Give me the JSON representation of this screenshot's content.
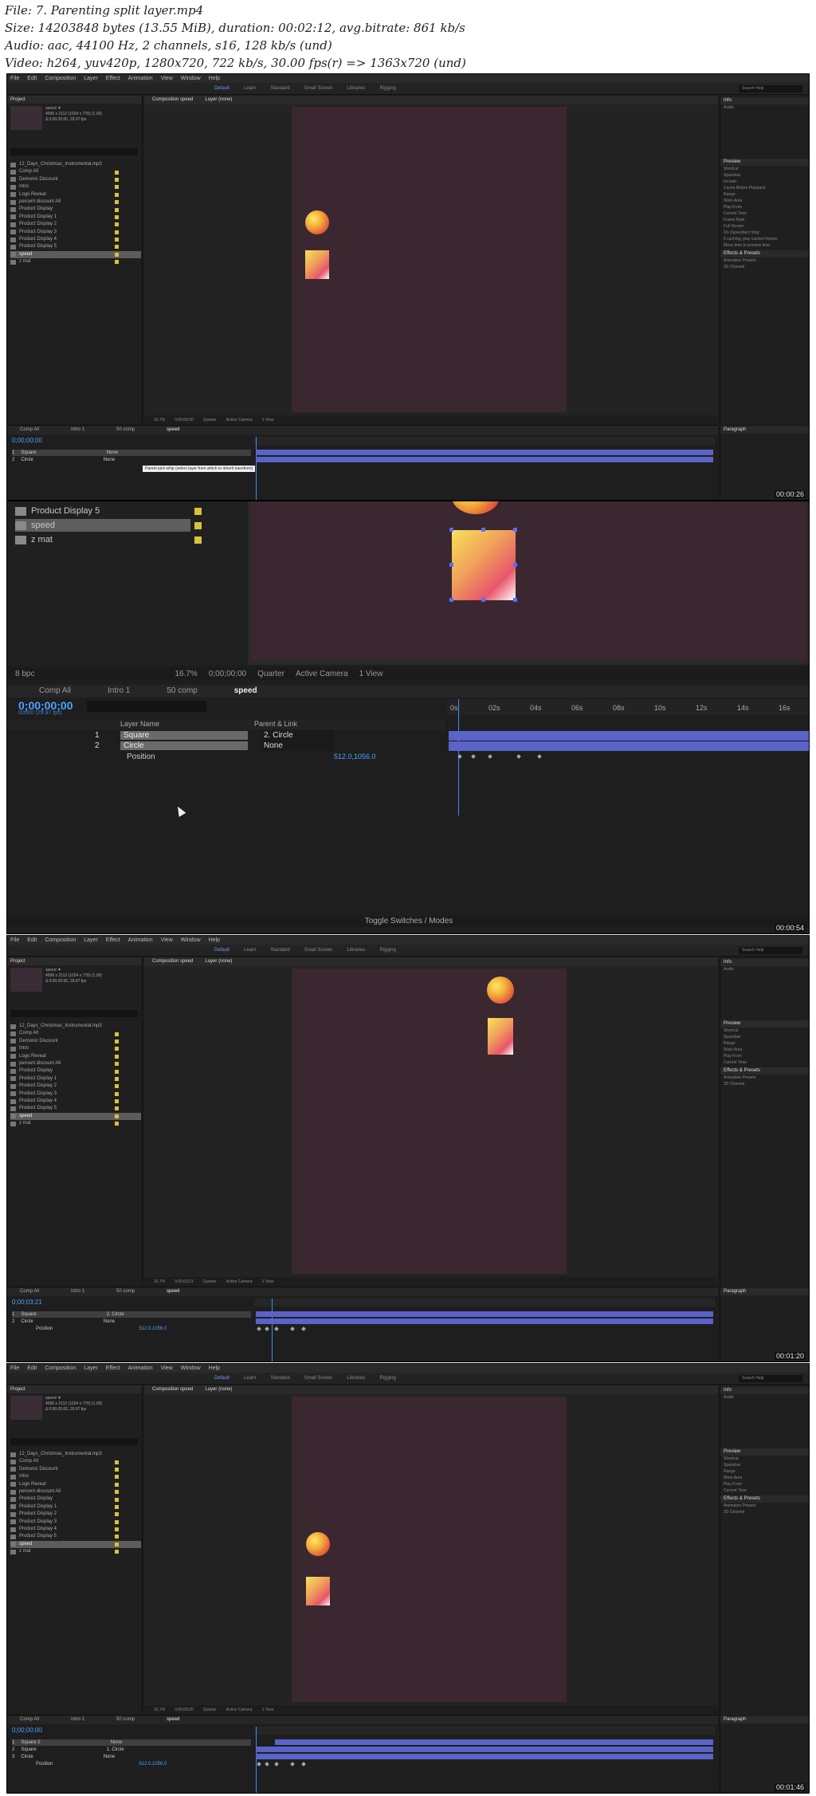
{
  "file_info": {
    "line1": "File: 7. Parenting  split layer.mp4",
    "line2": "Size: 14203848 bytes (13.55 MiB), duration: 00:02:12, avg.bitrate: 861 kb/s",
    "line3": "Audio: aac, 44100 Hz, 2 channels, s16, 128 kb/s (und)",
    "line4": "Video: h264, yuv420p, 1280x720, 722 kb/s, 30.00 fps(r) => 1363x720 (und)"
  },
  "timestamps": [
    "00:00:26",
    "00:00:54",
    "00:01:20",
    "00:01:46"
  ],
  "menu": [
    "File",
    "Edit",
    "Composition",
    "Layer",
    "Effect",
    "Animation",
    "View",
    "Window",
    "Help"
  ],
  "workspaces": [
    "Default",
    "Learn",
    "Standard",
    "Small Screen",
    "Libraries",
    "Rigging"
  ],
  "search_help": "Search Help",
  "project": {
    "tab": "Project",
    "comp_name": "speed ▼",
    "comp_meta": [
      "4096 x 2112 (1024 x 778) (1.00)",
      "Δ 0:00:20:00, 29.97 fps"
    ],
    "items": [
      "12_Days_Christmas_Instrumental.mp3",
      "Comp All",
      "Demonic Discount",
      "Intro",
      "Logo Reveal",
      "percent discount All",
      "Product Display",
      "Product Display 1",
      "Product Display 2",
      "Product Display 3",
      "Product Display 4",
      "Product Display 5",
      "speed",
      "z mat"
    ],
    "selected": "speed"
  },
  "composition_tab": "Composition speed",
  "layer_tab": "Layer (none)",
  "comp_bar": [
    "16.7%",
    "0;00;00;00",
    "Quarter",
    "Active Camera",
    "1 View"
  ],
  "right_panel": [
    "Info",
    "Audio",
    "Preview",
    "Shortcut",
    "Spacebar",
    "Include:",
    "Cache Before Playback",
    "Range",
    "Work Area",
    "Play From",
    "Current Time",
    "Frame Rate",
    "Skip",
    "Resolution",
    "Full Screen",
    "On (Spacebar) Stop:",
    "If caching, play cached frames",
    "Move time to preview time",
    "Effects & Presets",
    "Libraries",
    "Animation Presets",
    "3D Channel",
    "Paragraph"
  ],
  "timeline": {
    "tabs": [
      "Comp All",
      "Intro 1",
      "50 comp",
      "speed"
    ],
    "timecode": "0;00;00;00",
    "timecode_sub": "00000 (29.97 fps)",
    "ruler": [
      "0s",
      "02s",
      "04s",
      "06s",
      "08s",
      "10s",
      "12s",
      "14s",
      "16s"
    ],
    "columns": [
      "Layer Name",
      "Parent & Link"
    ],
    "layers": [
      {
        "num": "1",
        "name": "Square",
        "parent": "2. Circle"
      },
      {
        "num": "2",
        "name": "Circle",
        "parent": "None"
      }
    ],
    "layers_f1": [
      {
        "num": "1",
        "name": "Square",
        "parent": "None"
      },
      {
        "num": "2",
        "name": "Circle",
        "parent": "None"
      }
    ],
    "layers_f4": [
      {
        "num": "1",
        "name": "Square 2",
        "parent": "None"
      },
      {
        "num": "2",
        "name": "Square",
        "parent": "1. Circle"
      },
      {
        "num": "3",
        "name": "Circle",
        "parent": "None"
      }
    ],
    "property": "Position",
    "property_value": "512.0,1056.0",
    "footer": "Toggle Switches / Modes",
    "tooltip": "Parent pick whip (select layer from which to inherit transform)",
    "timecode_f3": "0;00;03;21"
  },
  "zoom": {
    "items": [
      "Product Display 5",
      "speed",
      "z mat"
    ],
    "bpc": "8 bpc",
    "zoom_pct": "16.7%",
    "tc": "0;00;00;00",
    "res": "Quarter",
    "camera": "Active Camera",
    "view": "1 View"
  }
}
